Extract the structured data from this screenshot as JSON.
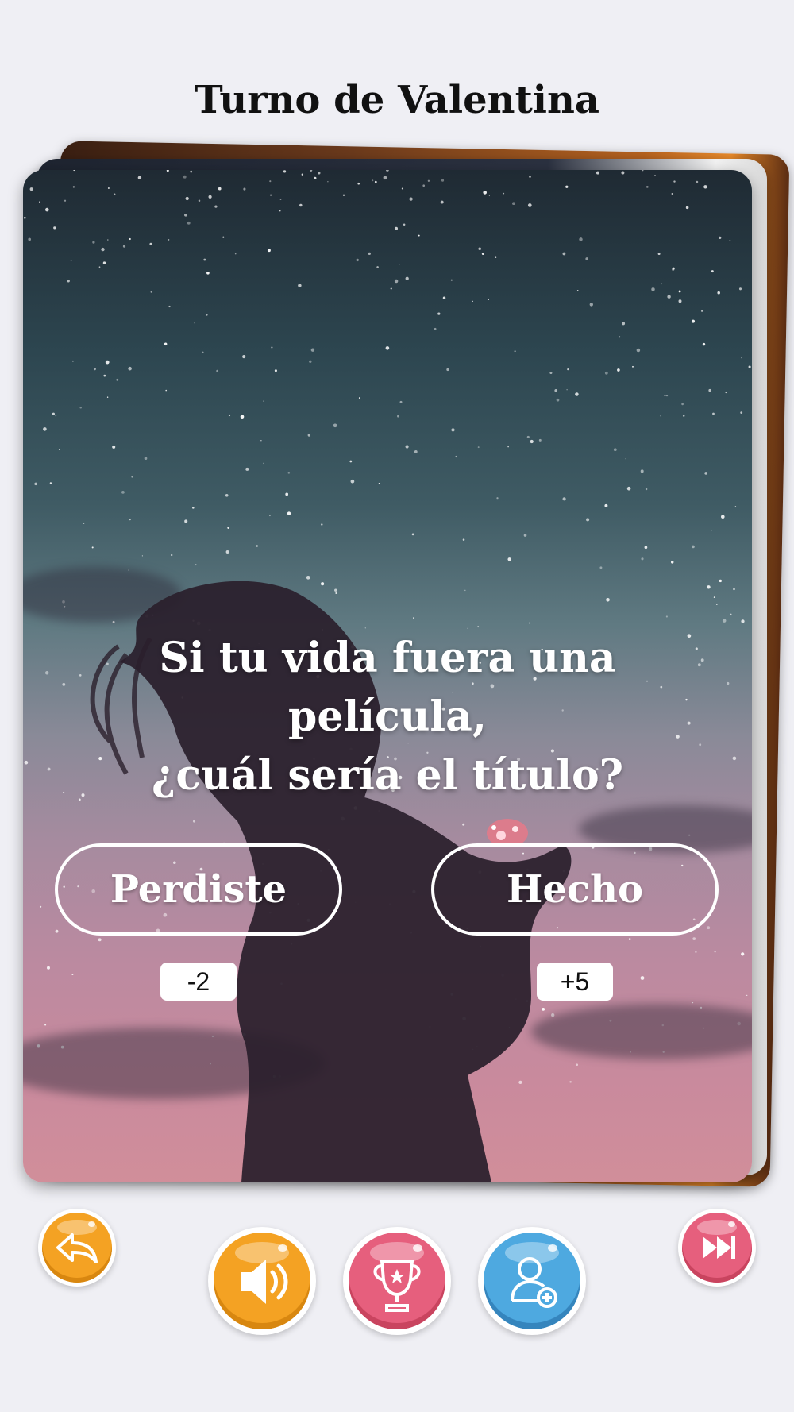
{
  "header": {
    "title": "Turno de Valentina"
  },
  "card": {
    "question_line1": "Si tu vida fuera una película,",
    "question_line2": "¿cuál sería el título?",
    "lost_label": "Perdiste",
    "done_label": "Hecho",
    "lost_points": "-2",
    "done_points": "+5"
  },
  "bottom_bar": {
    "back_icon": "undo-arrow-icon",
    "sound_icon": "speaker-icon",
    "ranking_icon": "trophy-icon",
    "add_player_icon": "add-user-icon",
    "skip_icon": "fast-forward-icon"
  },
  "colors": {
    "orange": "#f4a223",
    "pink": "#e65f7d",
    "blue": "#4ea9e0",
    "background": "#efeff4"
  }
}
